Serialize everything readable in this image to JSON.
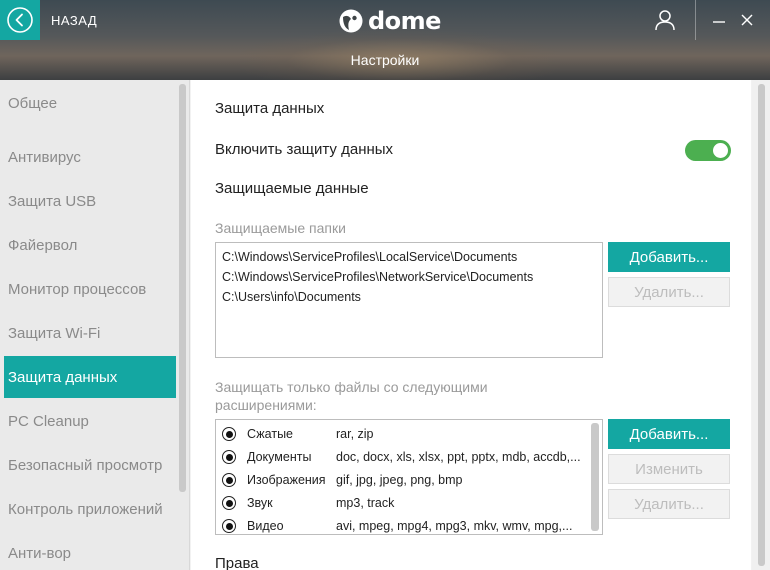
{
  "header": {
    "back_label": "НАЗАД",
    "logo_text": "dome",
    "title": "Настройки"
  },
  "sidebar": {
    "items": [
      {
        "label": "Общее",
        "active": false
      },
      {
        "label": "Антивирус",
        "active": false
      },
      {
        "label": "Защита USB",
        "active": false
      },
      {
        "label": "Файервол",
        "active": false
      },
      {
        "label": "Монитор процессов",
        "active": false
      },
      {
        "label": "Защита Wi-Fi",
        "active": false
      },
      {
        "label": "Защита данных",
        "active": true
      },
      {
        "label": "PC Cleanup",
        "active": false
      },
      {
        "label": "Безопасный просмотр",
        "active": false
      },
      {
        "label": "Контроль приложений",
        "active": false
      },
      {
        "label": "Анти-вор",
        "active": false
      }
    ]
  },
  "main": {
    "section_title": "Защита данных",
    "enable_label": "Включить защиту данных",
    "enable_on": true,
    "protected_title": "Защищаемые данные",
    "folders_label": "Защищаемые папки",
    "folders": [
      "C:\\Windows\\ServiceProfiles\\LocalService\\Documents",
      "C:\\Windows\\ServiceProfiles\\NetworkService\\Documents",
      "C:\\Users\\info\\Documents"
    ],
    "folders_add": "Добавить...",
    "folders_remove": "Удалить...",
    "ext_label": "Защищать только файлы со следующими расширениями:",
    "extensions": [
      {
        "name": "Сжатые",
        "values": "rar, zip"
      },
      {
        "name": "Документы",
        "values": "doc, docx, xls, xlsx, ppt, pptx, mdb, accdb,..."
      },
      {
        "name": "Изображения",
        "values": "gif, jpg, jpeg, png, bmp"
      },
      {
        "name": "Звук",
        "values": "mp3, track"
      },
      {
        "name": "Видео",
        "values": "avi, mpeg, mpg4, mpg3, mkv, wmv, mpg,..."
      }
    ],
    "ext_add": "Добавить...",
    "ext_change": "Изменить",
    "ext_remove": "Удалить...",
    "rights_title": "Права"
  },
  "colors": {
    "accent": "#14a7a2",
    "toggle_on": "#4caf50"
  }
}
